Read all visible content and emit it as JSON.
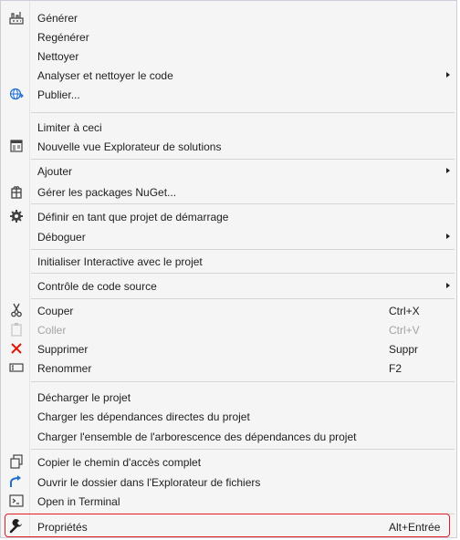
{
  "menu": {
    "items": [
      {
        "label": "Générer",
        "icon": "build-icon"
      },
      {
        "label": "Regénérer"
      },
      {
        "label": "Nettoyer"
      },
      {
        "label": "Analyser et nettoyer le code",
        "submenu": true
      },
      {
        "label": "Publier...",
        "icon": "publish-globe-icon"
      },
      {
        "label": "Limiter à ceci"
      },
      {
        "label": "Nouvelle vue Explorateur de solutions",
        "icon": "new-solution-view-icon"
      },
      {
        "label": "Ajouter",
        "submenu": true
      },
      {
        "label": "Gérer les packages NuGet...",
        "icon": "nuget-package-icon"
      },
      {
        "label": "Définir en tant que projet de démarrage",
        "icon": "gear-icon"
      },
      {
        "label": "Déboguer",
        "submenu": true
      },
      {
        "label": "Initialiser Interactive avec le projet"
      },
      {
        "label": "Contrôle de code source",
        "submenu": true
      },
      {
        "label": "Couper",
        "shortcut": "Ctrl+X",
        "icon": "cut-icon"
      },
      {
        "label": "Coller",
        "shortcut": "Ctrl+V",
        "icon": "paste-icon",
        "disabled": true
      },
      {
        "label": "Supprimer",
        "shortcut": "Suppr",
        "icon": "delete-icon"
      },
      {
        "label": "Renommer",
        "shortcut": "F2",
        "icon": "rename-icon"
      },
      {
        "label": "Décharger le projet"
      },
      {
        "label": "Charger les dépendances directes du projet"
      },
      {
        "label": "Charger l'ensemble de l'arborescence des dépendances du projet"
      },
      {
        "label": "Copier le chemin d'accès complet",
        "icon": "copy-path-icon"
      },
      {
        "label": "Ouvrir le dossier dans l'Explorateur de fichiers",
        "icon": "open-folder-arrow-icon"
      },
      {
        "label": "Open in Terminal",
        "icon": "terminal-icon"
      },
      {
        "label": "Propriétés",
        "shortcut": "Alt+Entrée",
        "icon": "wrench-icon"
      }
    ]
  },
  "colors": {
    "menu_background": "#f5f5f5",
    "highlight_border": "#e41b23",
    "delete_icon": "#e51400",
    "accent_blue": "#1e6fd2"
  }
}
